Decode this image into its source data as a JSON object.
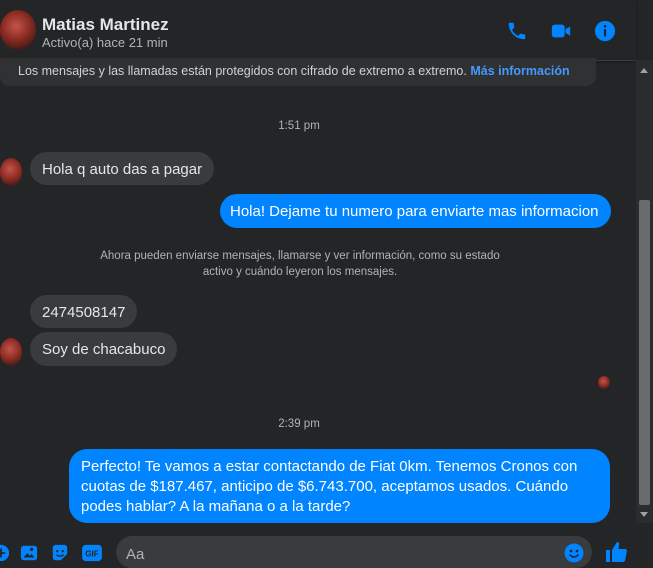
{
  "header": {
    "name": "Matias Martinez",
    "status": "Activo(a) hace 21 min",
    "icons": [
      "phone-icon",
      "video-call-icon",
      "info-icon"
    ],
    "accent_color": "#0084ff"
  },
  "encryption_notice": {
    "text": "Los mensajes y las llamadas están protegidos con cifrado de extremo a extremo.",
    "link": "Más información"
  },
  "timestamps": [
    "1:51 pm",
    "2:39 pm"
  ],
  "messages": [
    {
      "from": "contact",
      "text": "Hola q auto das a pagar"
    },
    {
      "from": "me",
      "text": "Hola! Dejame tu numero para enviarte mas informacion"
    },
    {
      "from": "contact",
      "text": "2474508147"
    },
    {
      "from": "contact",
      "text": "Soy de chacabuco"
    },
    {
      "from": "me",
      "lines": [
        "Perfecto! Te vamos a estar contactando de Fiat 0km. Tenemos Cronos con",
        "cuotas de $187.467, anticipo de $6.743.700, aceptamos usados. Cuándo",
        "podes hablar? A la mañana o a la tarde?"
      ]
    }
  ],
  "system_notice": {
    "line1": "Ahora pueden enviarse mensajes, llamarse y ver información, como su estado",
    "line2": "activo y cuándo leyeron los mensajes."
  },
  "composer": {
    "placeholder": "Aa",
    "icons": [
      "add-icon",
      "image-icon",
      "sticker-icon",
      "gif-icon",
      "emoji-icon",
      "like-icon"
    ]
  }
}
